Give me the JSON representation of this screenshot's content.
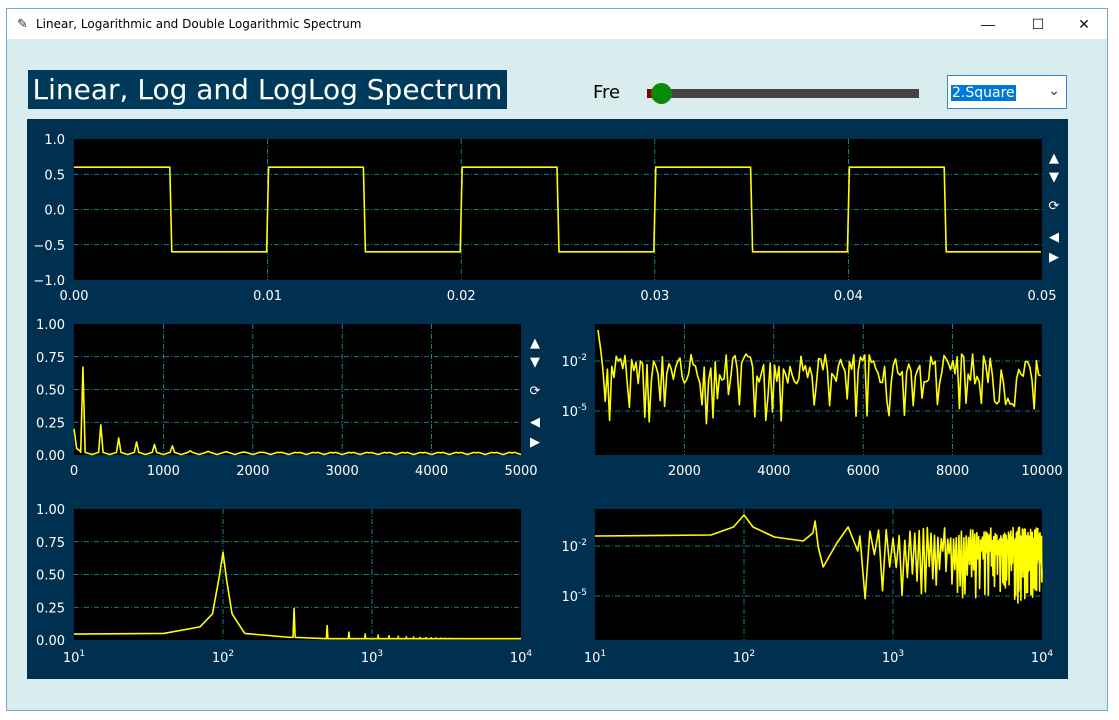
{
  "window": {
    "title": "Linear, Logarithmic and Double Logarithmic Spectrum",
    "minimize": "—",
    "maximize": "☐",
    "close": "✕"
  },
  "header": {
    "title": "Linear, Log and LogLog Spectrum"
  },
  "controls": {
    "fre_label": "Fre",
    "slider_value": 0.03,
    "waveform_selected": "2.Square"
  },
  "nav": {
    "up": "▲",
    "down": "▼",
    "refresh": "⟳",
    "left": "◀",
    "right": "▶"
  },
  "colors": {
    "line": "#ffff00",
    "grid": "#1fa0b0",
    "plot_bg": "#000000",
    "panel_bg": "#003050",
    "axis_text": "#ffffff"
  },
  "chart_data": [
    {
      "type": "line",
      "series": [
        {
          "x_period": 0.01,
          "high": 0.6,
          "low": -0.6,
          "x_range": [
            0,
            0.05
          ]
        }
      ],
      "xlim": [
        0,
        0.05
      ],
      "ylim": [
        -1.0,
        1.0
      ],
      "xticks": [
        "0.00",
        "0.01",
        "0.02",
        "0.03",
        "0.04",
        "0.05"
      ],
      "yticks": [
        "1.0",
        "0.5",
        "0.0",
        "−0.5",
        "−1.0"
      ],
      "grid": true
    },
    {
      "type": "line",
      "peaks": [
        {
          "x": 100,
          "y": 0.67
        },
        {
          "x": 300,
          "y": 0.23
        },
        {
          "x": 500,
          "y": 0.13
        },
        {
          "x": 700,
          "y": 0.1
        },
        {
          "x": 900,
          "y": 0.08
        },
        {
          "x": 1100,
          "y": 0.07
        }
      ],
      "xlim": [
        0,
        5000
      ],
      "ylim": [
        0,
        1.0
      ],
      "xticks": [
        "0",
        "1000",
        "2000",
        "3000",
        "4000",
        "5000"
      ],
      "yticks": [
        "1.00",
        "0.75",
        "0.50",
        "0.25",
        "0.00"
      ],
      "grid": true
    },
    {
      "type": "line",
      "xscale": "linear",
      "yscale": "log",
      "xlim": [
        0,
        10000
      ],
      "xticks": [
        "2000",
        "4000",
        "6000",
        "8000",
        "10000"
      ],
      "yticks": [
        "10^-2",
        "10^-5"
      ],
      "grid": true
    },
    {
      "type": "line",
      "xscale": "log",
      "yscale": "linear",
      "peaks": [
        {
          "x": 100,
          "y": 0.67
        },
        {
          "x": 300,
          "y": 0.24
        },
        {
          "x": 500,
          "y": 0.11
        }
      ],
      "xlim": [
        10,
        10000
      ],
      "ylim": [
        0,
        1.0
      ],
      "xticks": [
        "10^1",
        "10^2",
        "10^3",
        "10^4"
      ],
      "yticks": [
        "1.00",
        "0.75",
        "0.50",
        "0.25",
        "0.00"
      ],
      "grid": true
    },
    {
      "type": "line",
      "xscale": "log",
      "yscale": "log",
      "xlim": [
        10,
        10000
      ],
      "xticks": [
        "10^1",
        "10^2",
        "10^3",
        "10^4"
      ],
      "yticks": [
        "10^-2",
        "10^-5"
      ],
      "grid": true
    }
  ]
}
